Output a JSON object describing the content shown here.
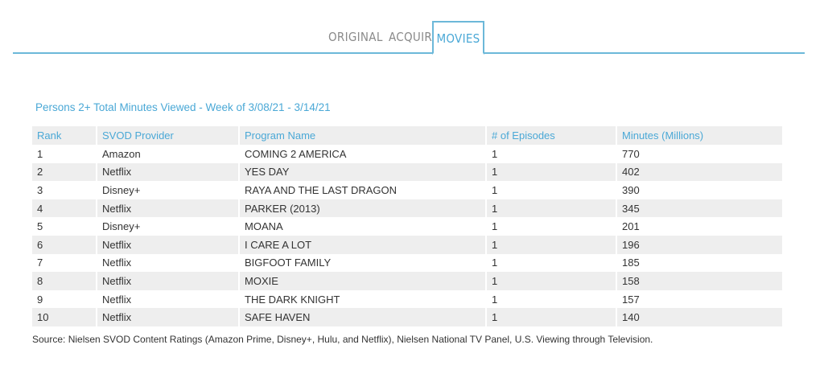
{
  "tabs": {
    "original": "ORIGINAL",
    "acquired": "ACQUIRED",
    "movies": "MOVIES"
  },
  "table": {
    "title": "Persons 2+ Total Minutes Viewed - Week of 3/08/21 - 3/14/21",
    "headers": {
      "rank": "Rank",
      "provider": "SVOD Provider",
      "program": "Program Name",
      "episodes": "# of Episodes",
      "minutes": "Minutes (Millions)"
    },
    "rows": [
      {
        "rank": "1",
        "provider": "Amazon",
        "program": "COMING 2 AMERICA",
        "episodes": "1",
        "minutes": "770"
      },
      {
        "rank": "2",
        "provider": "Netflix",
        "program": "YES DAY",
        "episodes": "1",
        "minutes": "402"
      },
      {
        "rank": "3",
        "provider": "Disney+",
        "program": "RAYA AND THE LAST DRAGON",
        "episodes": "1",
        "minutes": "390"
      },
      {
        "rank": "4",
        "provider": "Netflix",
        "program": "PARKER (2013)",
        "episodes": "1",
        "minutes": "345"
      },
      {
        "rank": "5",
        "provider": "Disney+",
        "program": "MOANA",
        "episodes": "1",
        "minutes": "201"
      },
      {
        "rank": "6",
        "provider": "Netflix",
        "program": "I CARE A LOT",
        "episodes": "1",
        "minutes": "196"
      },
      {
        "rank": "7",
        "provider": "Netflix",
        "program": "BIGFOOT FAMILY",
        "episodes": "1",
        "minutes": "185"
      },
      {
        "rank": "8",
        "provider": "Netflix",
        "program": "MOXIE",
        "episodes": "1",
        "minutes": "158"
      },
      {
        "rank": "9",
        "provider": "Netflix",
        "program": "THE DARK KNIGHT",
        "episodes": "1",
        "minutes": "157"
      },
      {
        "rank": "10",
        "provider": "Netflix",
        "program": "SAFE HAVEN",
        "episodes": "1",
        "minutes": "140"
      }
    ]
  },
  "source": "Source: Nielsen SVOD Content Ratings (Amazon Prime, Disney+, Hulu, and Netflix), Nielsen National TV Panel, U.S. Viewing through Television.",
  "colors": {
    "accent": "#4aa8d6",
    "tab_border": "#6cb8d9",
    "stripe": "#eeeeee"
  }
}
